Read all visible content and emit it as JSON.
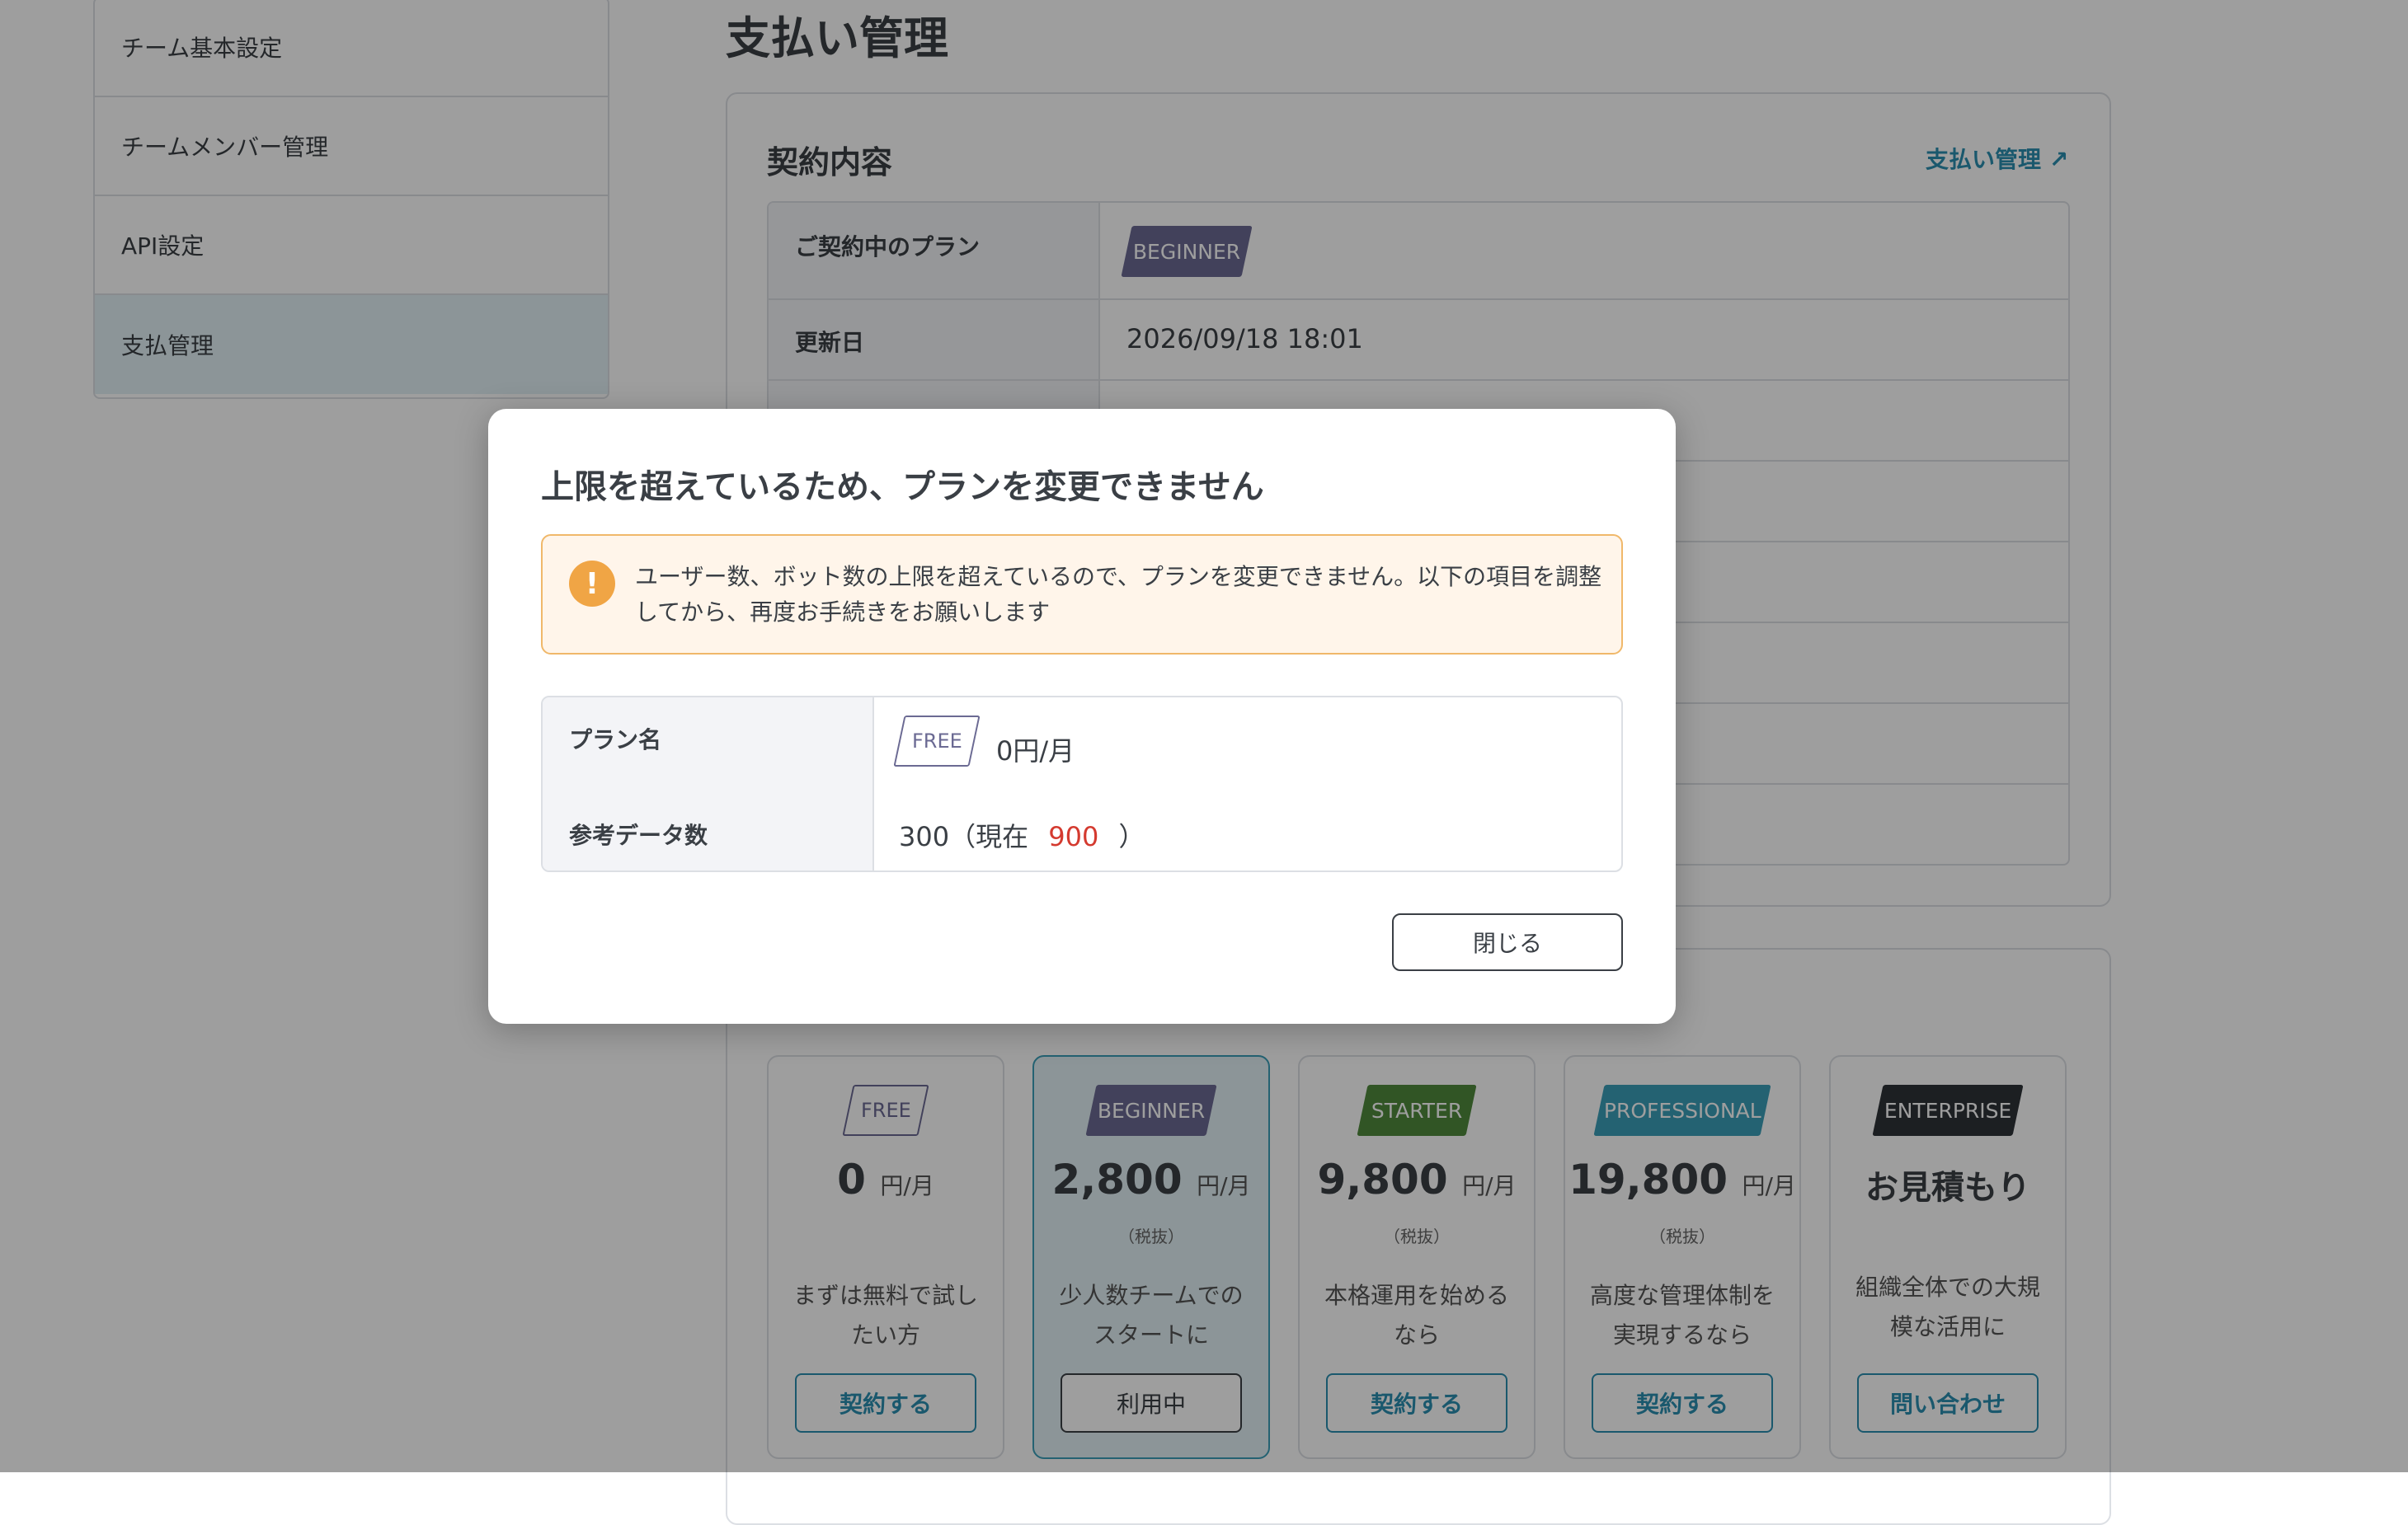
{
  "sidebar": {
    "items": [
      {
        "label": "チーム基本設定"
      },
      {
        "label": "チームメンバー管理"
      },
      {
        "label": "API設定"
      },
      {
        "label": "支払管理"
      }
    ]
  },
  "page": {
    "title": "支払い管理"
  },
  "contract": {
    "title": "契約内容",
    "manage_link": "支払い管理 ↗",
    "rows": [
      {
        "label": "ご契約中のプラン",
        "badge": "BEGINNER"
      },
      {
        "label": "更新日",
        "value": "2026/09/18 18:01"
      }
    ]
  },
  "plans": [
    {
      "badge": "FREE",
      "price": "0",
      "unit": "円/月",
      "tax": "",
      "desc": "まずは無料で試したい方",
      "button": "契約する",
      "color": "#6b6a93"
    },
    {
      "badge": "BEGINNER",
      "price": "2,800",
      "unit": "円/月",
      "tax": "（税抜）",
      "desc": "少人数チームでのスタートに",
      "button": "利用中",
      "color": "#6b6a93"
    },
    {
      "badge": "STARTER",
      "price": "9,800",
      "unit": "円/月",
      "tax": "（税抜）",
      "desc": "本格運用を始めるなら",
      "button": "契約する",
      "color": "#4f8a3c"
    },
    {
      "badge": "PROFESSIONAL",
      "price": "19,800",
      "unit": "円/月",
      "tax": "（税抜）",
      "desc": "高度な管理体制を実現するなら",
      "button": "契約する",
      "color": "#3a9fb8"
    },
    {
      "badge": "ENTERPRISE",
      "price": "お見積もり",
      "unit": "",
      "tax": "",
      "desc": "組織全体での大規模な活用に",
      "button": "問い合わせ",
      "color": "#2e3238"
    }
  ],
  "modal": {
    "title": "上限を超えているため、プランを変更できません",
    "alert_icon": "!",
    "alert_text": "ユーザー数、ボット数の上限を超えているので、プランを変更できません。以下の項目を調整してから、再度お手続きをお願いします",
    "plan_label": "プラン名",
    "plan_badge": "FREE",
    "plan_price": "0円/月",
    "data_label": "参考データ数",
    "data_limit": "300（現在",
    "data_current": "900",
    "data_close_paren": "）",
    "close_button": "閉じる"
  },
  "colors": {
    "accent": "#2b8fb0",
    "beginner": "#6b6a93",
    "starter": "#4f8a3c",
    "professional": "#3a9fb8",
    "enterprise": "#2e3238",
    "warning": "#f0a545",
    "error": "#d43a2f"
  }
}
